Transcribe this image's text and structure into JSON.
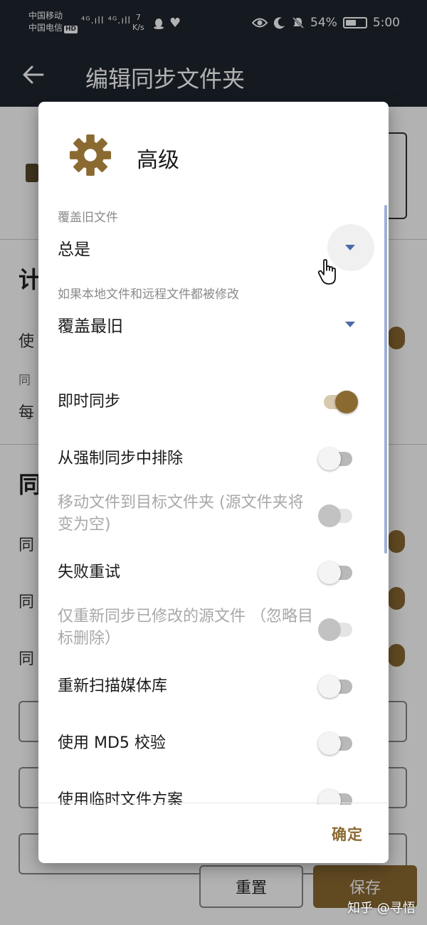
{
  "status_bar": {
    "carrier1": "中国移动",
    "carrier2": "中国电信",
    "hd": "HD",
    "signal": "⁴ᴳ.ıll ⁴ᴳ.ıll",
    "speed_value": "7",
    "speed_unit": "K/s",
    "battery": "54%",
    "battery_level": 0.54,
    "time": "5:00"
  },
  "app_bar": {
    "title": "编辑同步文件夹"
  },
  "background": {
    "section1_heading": "计",
    "row_use": "使",
    "hint_sync": "同",
    "row_every": "每",
    "section2_heading": "同",
    "row_sync1": "同",
    "row_sync2": "同",
    "row_sync3": "同",
    "reset_label": "重置",
    "save_label": "保存"
  },
  "dialog": {
    "title": "高级",
    "icon": "gear-icon",
    "overwrite_label": "覆盖旧文件",
    "overwrite_value": "总是",
    "conflict_label": "如果本地文件和远程文件都被修改",
    "conflict_value": "覆盖最旧",
    "toggles": [
      {
        "label": "即时同步",
        "state": "on"
      },
      {
        "label": "从强制同步中排除",
        "state": "off"
      },
      {
        "label": "移动文件到目标文件夹 (源文件夹将变为空)",
        "state": "disabled"
      },
      {
        "label": "失败重试",
        "state": "off"
      },
      {
        "label": "仅重新同步已修改的源文件 （忽略目标删除）",
        "state": "disabled"
      },
      {
        "label": "重新扫描媒体库",
        "state": "off"
      },
      {
        "label": "使用 MD5 校验",
        "state": "off"
      },
      {
        "label": "使用临时文件方案",
        "state": "off"
      }
    ],
    "ok_label": "确定"
  },
  "watermark": "知乎 @寻悟",
  "colors": {
    "accent": "#8b6a32",
    "appbar": "#1f2630",
    "dropdown_arrow": "#4a6aa8"
  }
}
